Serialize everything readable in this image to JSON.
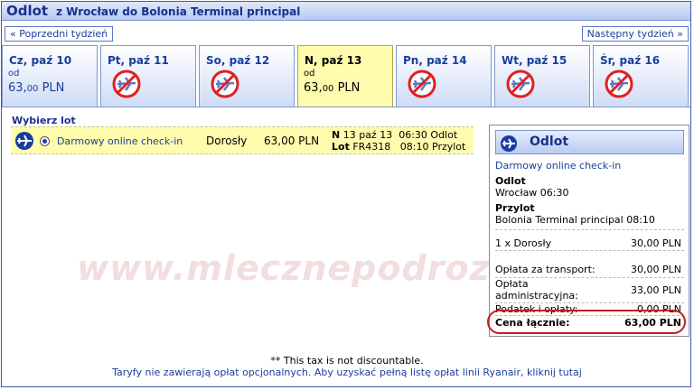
{
  "header": {
    "title": "Odlot",
    "route": "z Wrocław do Bolonia Terminal principal"
  },
  "nav": {
    "prev": "« Poprzedni tydzień",
    "next": "Następny tydzień »"
  },
  "days": [
    {
      "label": "Cz, paź 10",
      "od": "od",
      "price_main": "63,",
      "price_dec": "00",
      "currency": "PLN",
      "available": true,
      "selected": false
    },
    {
      "label": "Pt, paź 11",
      "available": false,
      "selected": false
    },
    {
      "label": "So, paź 12",
      "available": false,
      "selected": false
    },
    {
      "label": "N, paź 13",
      "od": "od",
      "price_main": "63,",
      "price_dec": "00",
      "currency": "PLN",
      "available": true,
      "selected": true
    },
    {
      "label": "Pn, paź 14",
      "available": false,
      "selected": false
    },
    {
      "label": "Wt, paź 15",
      "available": false,
      "selected": false
    },
    {
      "label": "Śr, paź 16",
      "available": false,
      "selected": false
    }
  ],
  "watermark": "www.mlecznepodroze.pl",
  "select_flight": {
    "title": "Wybierz lot",
    "checkin": "Darmowy online check-in",
    "passenger_type": "Dorosły",
    "price": "63,00 PLN",
    "date_label": "N",
    "date": "13 paź 13",
    "flight_label": "Lot",
    "flight_no": "FR4318",
    "dep_time": "06:30",
    "dep_label": "Odlot",
    "arr_time": "08:10",
    "arr_label": "Przylot"
  },
  "summary": {
    "title": "Odlot",
    "checkin": "Darmowy online check-in",
    "dep_label": "Odlot",
    "dep_value": "Wrocław 06:30",
    "arr_label": "Przylot",
    "arr_value": "Bolonia Terminal principal 08:10",
    "pax_label": "1 x Dorosły",
    "pax_amount": "30,00 PLN",
    "transport_label": "Opłata za transport:",
    "transport_amount": "30,00 PLN",
    "admin_label_1": "Opłata",
    "admin_label_2": "administracyjna:",
    "admin_amount": "33,00 PLN",
    "tax_label": "Podatek i opłaty:",
    "tax_amount": "0,00 PLN",
    "total_label": "Cena łącznie:",
    "total_amount": "63,00 PLN"
  },
  "footer": {
    "note": "** This tax is not discountable.",
    "link": "Taryfy nie zawierają opłat opcjonalnych. Aby uzyskać pełną listę opłat linii Ryanair, kliknij tutaj"
  },
  "colors": {
    "accent": "#1a3d9c",
    "selected_day": "#fffcae",
    "highlight_ring": "#cc1a1a"
  }
}
